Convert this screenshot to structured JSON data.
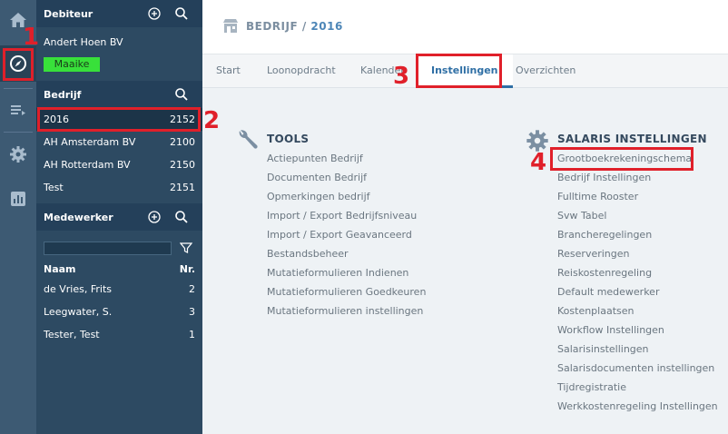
{
  "rail": {
    "items": [
      {
        "icon": "home-icon"
      },
      {
        "icon": "compass-icon"
      },
      {
        "icon": "list-icon"
      },
      {
        "icon": "gear-icon"
      },
      {
        "icon": "chart-icon"
      }
    ]
  },
  "panel": {
    "debiteur": {
      "title": "Debiteur",
      "name": "Andert Hoen BV",
      "badge": "Maaike"
    },
    "bedrijf": {
      "title": "Bedrijf",
      "rows": [
        {
          "label": "2016",
          "value": "2152"
        },
        {
          "label": "AH Amsterdam BV",
          "value": "2100"
        },
        {
          "label": "AH Rotterdam BV",
          "value": "2150"
        },
        {
          "label": "Test",
          "value": "2151"
        }
      ]
    },
    "medewerker": {
      "title": "Medewerker",
      "col_name": "Naam",
      "col_nr": "Nr.",
      "rows": [
        {
          "label": "de Vries, Frits",
          "value": "2"
        },
        {
          "label": "Leegwater, S.",
          "value": "3"
        },
        {
          "label": "Tester, Test",
          "value": "1"
        }
      ]
    }
  },
  "header": {
    "crumb_a": "BEDRIJF /",
    "crumb_b": "2016"
  },
  "tabs": [
    "Start",
    "Loonopdracht",
    "Kalender",
    "Instellingen",
    "Overzichten"
  ],
  "tools": {
    "title": "TOOLS",
    "links": [
      "Actiepunten Bedrijf",
      "Documenten Bedrijf",
      "Opmerkingen bedrijf",
      "Import / Export Bedrijfsniveau",
      "Import / Export Geavanceerd",
      "Bestandsbeheer",
      "Mutatieformulieren Indienen",
      "Mutatieformulieren Goedkeuren",
      "Mutatieformulieren instellingen"
    ]
  },
  "salaris": {
    "title": "SALARIS INSTELLINGEN",
    "links": [
      "Grootboekrekeningschema",
      "Bedrijf Instellingen",
      "Fulltime Rooster",
      "Svw Tabel",
      "Brancheregelingen",
      "Reserveringen",
      "Reiskostenregeling",
      "Default medewerker",
      "Kostenplaatsen",
      "Workflow Instellingen",
      "Salarisinstellingen",
      "Salarisdocumenten instellingen",
      "Tijdregistratie",
      "Werkkostenregeling Instellingen"
    ]
  },
  "annotations": [
    "1",
    "2",
    "3",
    "4"
  ]
}
